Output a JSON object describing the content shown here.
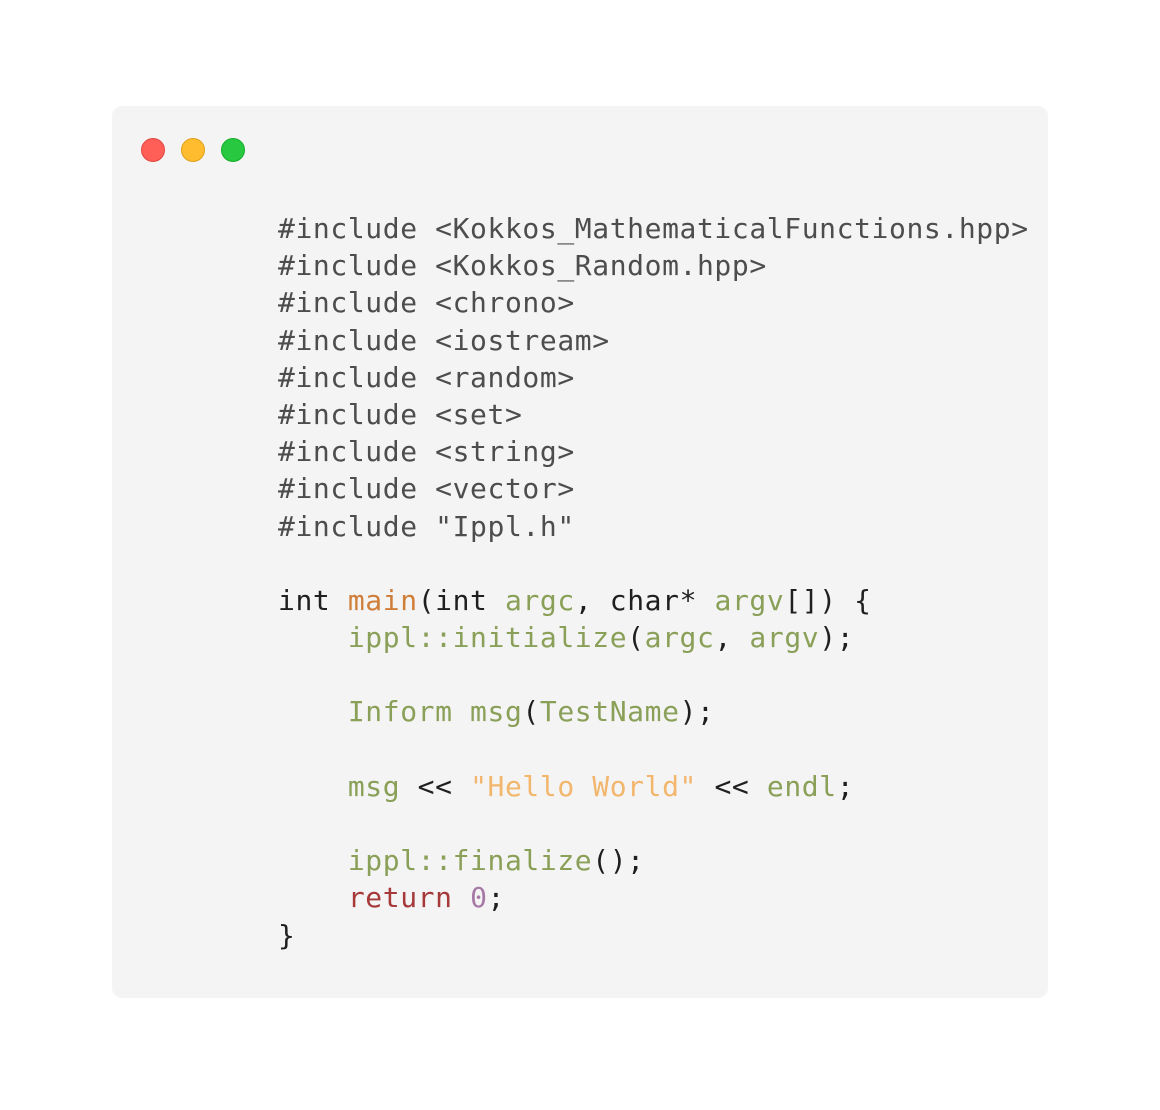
{
  "window": {
    "controls": {
      "close": "close-icon",
      "minimize": "minimize-icon",
      "zoom": "zoom-icon"
    }
  },
  "colors": {
    "window_bg": "#f4f4f4",
    "preprocessor": "#4d4d4d",
    "function_name": "#cf7f3a",
    "identifier": "#8aa058",
    "string": "#f2b66d",
    "keyword": "#a63a3a",
    "number": "#a779a6"
  },
  "code": {
    "includes": [
      "#include <Kokkos_MathematicalFunctions.hpp>",
      "#include <Kokkos_Random.hpp>",
      "#include <chrono>",
      "#include <iostream>",
      "#include <random>",
      "#include <set>",
      "#include <string>",
      "#include <vector>",
      "#include \"Ippl.h\""
    ],
    "main_sig": {
      "t1": "int ",
      "t2": "main",
      "t3": "(int ",
      "t4": "argc",
      "t5": ", char* ",
      "t6": "argv",
      "t7": "[]) {"
    },
    "init_line": {
      "indent": "    ",
      "t1": "ippl::initialize",
      "t2": "(",
      "t3": "argc",
      "t4": ", ",
      "t5": "argv",
      "t6": ");"
    },
    "inform_line": {
      "indent": "    ",
      "t1": "Inform msg",
      "t2": "(",
      "t3": "TestName",
      "t4": ");"
    },
    "msg_line": {
      "indent": "    ",
      "t1": "msg",
      "t2": " << ",
      "t3": "\"Hello World\"",
      "t4": " << ",
      "t5": "endl",
      "t6": ";"
    },
    "finalize_line": {
      "indent": "    ",
      "t1": "ippl::finalize",
      "t2": "();"
    },
    "return_line": {
      "indent": "    ",
      "t1": "return",
      "t2": " ",
      "t3": "0",
      "t4": ";"
    },
    "close_brace": "}"
  }
}
